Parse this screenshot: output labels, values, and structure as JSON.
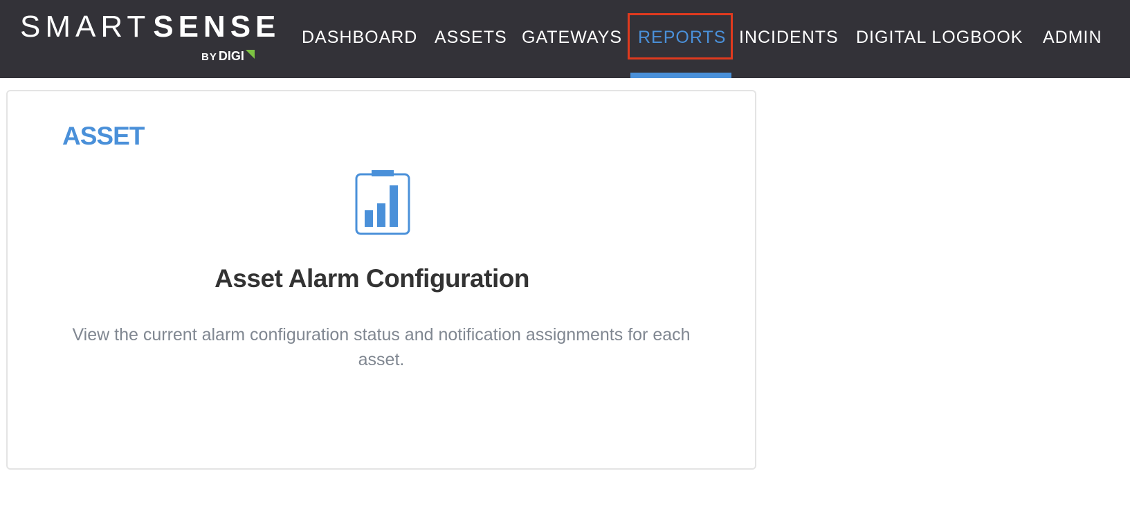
{
  "header": {
    "logo": {
      "word_light": "SMART",
      "word_bold": "SENSE",
      "by": "BY",
      "brand": "DIGI"
    },
    "nav": [
      {
        "label": "DASHBOARD",
        "active": false
      },
      {
        "label": "ASSETS",
        "active": false
      },
      {
        "label": "GATEWAYS",
        "active": false
      },
      {
        "label": "REPORTS",
        "active": true
      },
      {
        "label": "INCIDENTS",
        "active": false
      },
      {
        "label": "DIGITAL LOGBOOK",
        "active": false
      },
      {
        "label": "ADMIN",
        "active": false
      }
    ]
  },
  "report_card": {
    "category": "ASSET",
    "icon": "report-chart-icon",
    "title": "Asset Alarm Configuration",
    "description": "View the current alarm configuration status and notification assignments for each asset."
  },
  "colors": {
    "header_bg": "#333238",
    "accent": "#4a90d9",
    "highlight_box": "#e03a1e",
    "digi_green": "#7cc242"
  }
}
